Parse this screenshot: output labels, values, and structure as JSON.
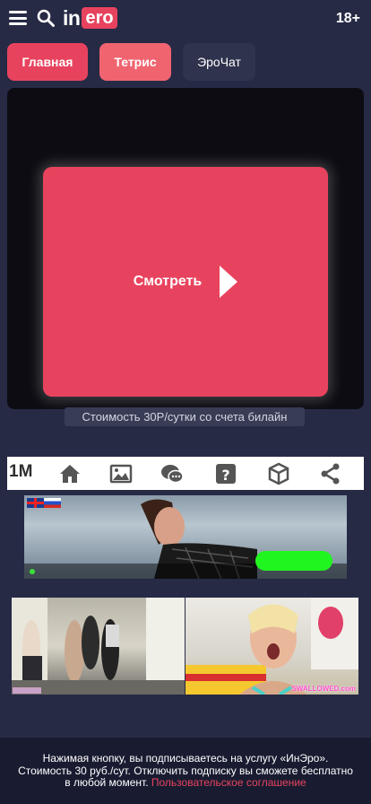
{
  "header": {
    "logo_in": "in",
    "logo_ero": "ero",
    "age_label": "18+"
  },
  "tabs": [
    {
      "label": "Главная"
    },
    {
      "label": "Тетрис"
    },
    {
      "label": "ЭроЧат"
    }
  ],
  "player": {
    "watch_label": "Смотреть",
    "price_note": "Стоимость 30Р/сутки со счета билайн"
  },
  "adbar": {
    "brand": "1M",
    "icons": [
      "home-icon",
      "image-icon",
      "chat-icon",
      "question-icon",
      "cube-icon",
      "share-icon"
    ]
  },
  "thumbs": {
    "second_watermark": "SWALLOWED.com"
  },
  "footer": {
    "text": "Нажимая кнопку, вы подписываетесь на услугу «ИнЭро». Стоимость 30 руб./сут. Отключить подписку вы сможете бесплатно в любой момент.",
    "link": "Пользовательское соглашение"
  },
  "colors": {
    "background": "#262a45",
    "accent": "#e8435e",
    "footer_bg": "#191c31"
  }
}
